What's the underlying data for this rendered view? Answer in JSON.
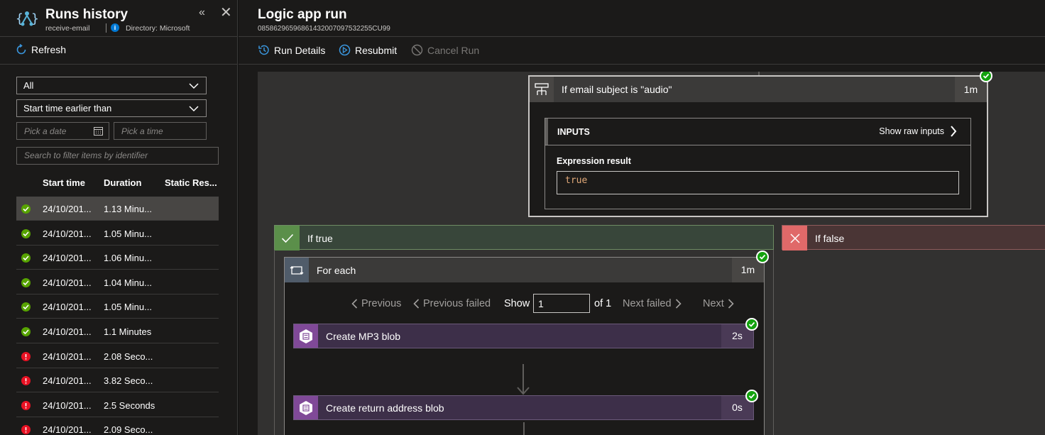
{
  "left_panel": {
    "title": "Runs history",
    "resource": "receive-email",
    "directory": "Directory: Microsoft",
    "info_icon": "i",
    "collapse_icon": "«",
    "close_icon": "✕",
    "refresh_label": "Refresh",
    "status_filter": "All",
    "time_filter": "Start time earlier than",
    "date_placeholder": "Pick a date",
    "time_placeholder": "Pick a time",
    "search_placeholder": "Search to filter items by identifier",
    "columns": [
      "Start time",
      "Duration",
      "Static Res..."
    ],
    "runs": [
      {
        "status": "succeeded",
        "start": "24/10/201...",
        "duration": "1.13 Minu..."
      },
      {
        "status": "succeeded",
        "start": "24/10/201...",
        "duration": "1.05 Minu..."
      },
      {
        "status": "succeeded",
        "start": "24/10/201...",
        "duration": "1.06 Minu..."
      },
      {
        "status": "succeeded",
        "start": "24/10/201...",
        "duration": "1.04 Minu..."
      },
      {
        "status": "succeeded",
        "start": "24/10/201...",
        "duration": "1.05 Minu..."
      },
      {
        "status": "succeeded",
        "start": "24/10/201...",
        "duration": "1.1 Minutes"
      },
      {
        "status": "failed",
        "start": "24/10/201...",
        "duration": "2.08 Seco..."
      },
      {
        "status": "failed",
        "start": "24/10/201...",
        "duration": "3.82 Seco..."
      },
      {
        "status": "failed",
        "start": "24/10/201...",
        "duration": "2.5 Seconds"
      },
      {
        "status": "failed",
        "start": "24/10/201...",
        "duration": "2.09 Seco..."
      }
    ]
  },
  "run": {
    "title": "Logic app run",
    "id": "08586296596861432007097532255CU99",
    "toolbar": {
      "run_details": "Run Details",
      "resubmit": "Resubmit",
      "cancel_run": "Cancel Run"
    }
  },
  "designer": {
    "condition": {
      "title": "If email subject is \"audio\"",
      "duration": "1m",
      "inputs_label": "INPUTS",
      "show_raw": "Show raw inputs",
      "expression_label": "Expression result",
      "expression_value": "true"
    },
    "if_true": "If true",
    "if_false": "If false",
    "foreach": {
      "title": "For each",
      "duration": "1m",
      "pager": {
        "previous": "Previous",
        "previous_failed": "Previous failed",
        "show": "Show",
        "current": "1",
        "of": "of 1",
        "next_failed": "Next failed",
        "next": "Next"
      }
    },
    "actions": [
      {
        "title": "Create MP3 blob",
        "duration": "2s"
      },
      {
        "title": "Create return address blob",
        "duration": "0s"
      }
    ]
  },
  "colors": {
    "success": "#13a10e",
    "failure": "#e81123",
    "true_branch": "#38463a",
    "false_branch": "#4a3535",
    "blob_action": "#3d2f49",
    "accent": "#0078d4"
  }
}
